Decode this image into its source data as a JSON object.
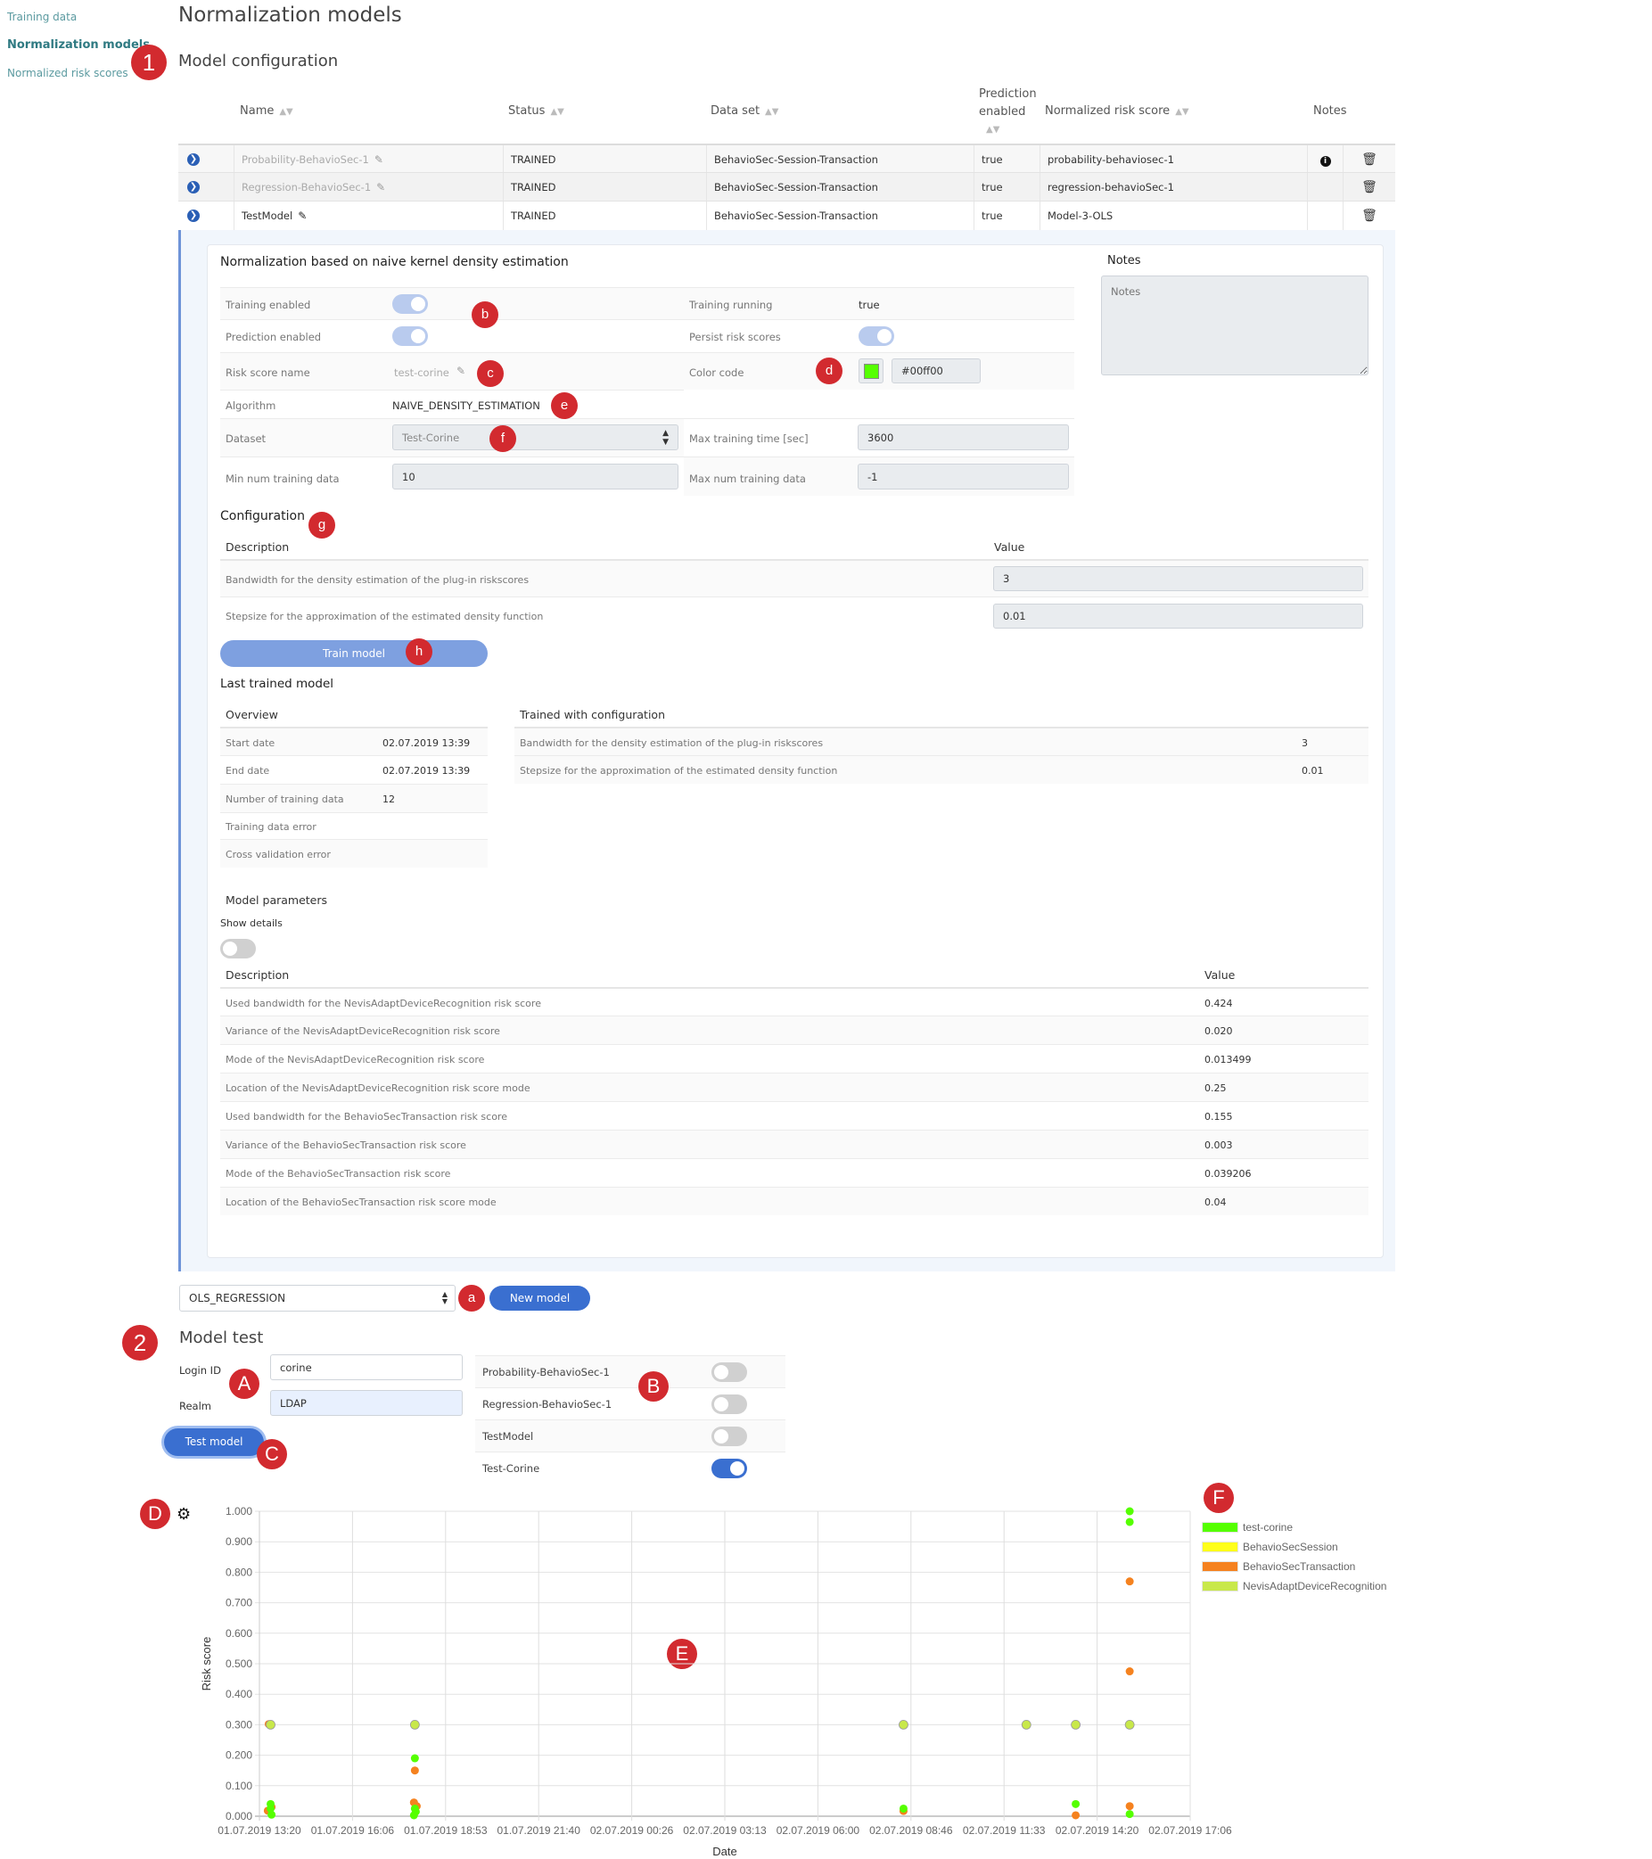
{
  "sidebar": {
    "items": [
      {
        "label": "Training data",
        "active": false
      },
      {
        "label": "Normalization models",
        "active": true
      },
      {
        "label": "Normalized risk scores",
        "active": false
      }
    ]
  },
  "page_title": "Normalization models",
  "annotations": {
    "n1": "1",
    "n2": "2",
    "a": "a",
    "b": "b",
    "c": "c",
    "d": "d",
    "e": "e",
    "f": "f",
    "g": "g",
    "h": "h",
    "A": "A",
    "B": "B",
    "C": "C",
    "D": "D",
    "E": "E",
    "F": "F"
  },
  "model_configuration": {
    "title": "Model configuration",
    "columns": {
      "name": "Name",
      "status": "Status",
      "dataset": "Data set",
      "prediction_enabled_1": "Prediction",
      "prediction_enabled_2": "enabled",
      "normalized_risk_score": "Normalized risk score",
      "notes": "Notes"
    },
    "rows": [
      {
        "name": "Probability-BehavioSec-1",
        "status": "TRAINED",
        "dataset": "BehavioSec-Session-Transaction",
        "prediction_enabled": "true",
        "normalized_risk_score": "probability-behaviosec-1",
        "has_note": true
      },
      {
        "name": "Regression-BehavioSec-1",
        "status": "TRAINED",
        "dataset": "BehavioSec-Session-Transaction",
        "prediction_enabled": "true",
        "normalized_risk_score": "regression-behavioSec-1",
        "has_note": false
      },
      {
        "name": "TestModel",
        "status": "TRAINED",
        "dataset": "BehavioSec-Session-Transaction",
        "prediction_enabled": "true",
        "normalized_risk_score": "Model-3-OLS",
        "has_note": false
      }
    ]
  },
  "detail": {
    "title": "Normalization based on naive kernel density estimation",
    "fields": {
      "training_enabled": {
        "label": "Training enabled",
        "value": true
      },
      "prediction_enabled": {
        "label": "Prediction enabled",
        "value": true
      },
      "risk_score_name": {
        "label": "Risk score name",
        "value": "test-corine"
      },
      "algorithm": {
        "label": "Algorithm",
        "value": "NAIVE_DENSITY_ESTIMATION"
      },
      "dataset": {
        "label": "Dataset",
        "value": "Test-Corine"
      },
      "min_num_training_data": {
        "label": "Min num training data",
        "value": "10"
      },
      "training_running": {
        "label": "Training running",
        "value": "true"
      },
      "persist_risk_scores": {
        "label": "Persist risk scores",
        "value": true
      },
      "color_code": {
        "label": "Color code",
        "value": "#00ff00",
        "swatch": "#55ff00"
      },
      "max_training_time": {
        "label": "Max training time [sec]",
        "value": "3600"
      },
      "max_num_training_data": {
        "label": "Max num training data",
        "value": "-1"
      }
    },
    "notes": {
      "label": "Notes",
      "placeholder": "Notes"
    },
    "configuration": {
      "title": "Configuration",
      "col_description": "Description",
      "col_value": "Value",
      "rows": [
        {
          "description": "Bandwidth for the density estimation of the plug-in riskscores",
          "value": "3"
        },
        {
          "description": "Stepsize for the approximation of the estimated density function",
          "value": "0.01"
        }
      ]
    },
    "train_button": "Train model",
    "last_trained": {
      "title": "Last trained model",
      "overview_title": "Overview",
      "overview": [
        {
          "label": "Start date",
          "value": "02.07.2019 13:39"
        },
        {
          "label": "End date",
          "value": "02.07.2019 13:39"
        },
        {
          "label": "Number of training data",
          "value": "12"
        },
        {
          "label": "Training data error",
          "value": ""
        },
        {
          "label": "Cross validation error",
          "value": ""
        }
      ],
      "trained_with_title": "Trained with configuration",
      "trained_with": [
        {
          "description": "Bandwidth for the density estimation of the plug-in riskscores",
          "value": "3"
        },
        {
          "description": "Stepsize for the approximation of the estimated density function",
          "value": "0.01"
        }
      ]
    },
    "model_parameters": {
      "title": "Model parameters",
      "show_details_label": "Show details",
      "show_details": false,
      "col_description": "Description",
      "col_value": "Value",
      "rows": [
        {
          "description": "Used bandwidth for the NevisAdaptDeviceRecognition risk score",
          "value": "0.424"
        },
        {
          "description": "Variance of the NevisAdaptDeviceRecognition risk score",
          "value": "0.020"
        },
        {
          "description": "Mode of the NevisAdaptDeviceRecognition risk score",
          "value": "0.013499"
        },
        {
          "description": "Location of the NevisAdaptDeviceRecognition risk score mode",
          "value": "0.25"
        },
        {
          "description": "Used bandwidth for the BehavioSecTransaction risk score",
          "value": "0.155"
        },
        {
          "description": "Variance of the BehavioSecTransaction risk score",
          "value": "0.003"
        },
        {
          "description": "Mode of the BehavioSecTransaction risk score",
          "value": "0.039206"
        },
        {
          "description": "Location of the BehavioSecTransaction risk score mode",
          "value": "0.04"
        }
      ]
    }
  },
  "new_model": {
    "algorithm_select": "OLS_REGRESSION",
    "button": "New model"
  },
  "model_test": {
    "title": "Model test",
    "login_id_label": "Login ID",
    "login_id_value": "corine",
    "realm_label": "Realm",
    "realm_value": "LDAP",
    "test_button": "Test model",
    "models": [
      {
        "name": "Probability-BehavioSec-1",
        "enabled": false
      },
      {
        "name": "Regression-BehavioSec-1",
        "enabled": false
      },
      {
        "name": "TestModel",
        "enabled": false
      },
      {
        "name": "Test-Corine",
        "enabled": true
      }
    ]
  },
  "chart_data": {
    "type": "scatter",
    "title": "",
    "xlabel": "Date",
    "ylabel": "Risk score",
    "grid": true,
    "legend_position": "right",
    "ylim": [
      0,
      1
    ],
    "yticks": [
      "0.000",
      "0.100",
      "0.200",
      "0.300",
      "0.400",
      "0.500",
      "0.600",
      "0.700",
      "0.800",
      "0.900",
      "1.000"
    ],
    "xticks": [
      "01.07.2019 13:20",
      "01.07.2019 16:06",
      "01.07.2019 18:53",
      "01.07.2019 21:40",
      "02.07.2019 00:26",
      "02.07.2019 03:13",
      "02.07.2019 06:00",
      "02.07.2019 08:46",
      "02.07.2019 11:33",
      "02.07.2019 14:20",
      "02.07.2019 17:06"
    ],
    "x_unit": "tick index (0 = 01.07.2019 13:20, step 2h46m40s)",
    "series": [
      {
        "name": "test-corine",
        "color": "#55ff00",
        "points": [
          [
            0.12,
            0.04
          ],
          [
            0.12,
            0.025
          ],
          [
            0.13,
            0.005
          ],
          [
            1.67,
            0.19
          ],
          [
            1.67,
            0.025
          ],
          [
            1.68,
            0.015
          ],
          [
            1.66,
            0.003
          ],
          [
            6.92,
            0.025
          ],
          [
            8.77,
            0.04
          ],
          [
            9.35,
            1.0
          ],
          [
            9.35,
            0.965
          ],
          [
            9.35,
            0.007
          ]
        ]
      },
      {
        "name": "BehavioSecSession",
        "color": "#ffff1a",
        "points": []
      },
      {
        "name": "BehavioSecTransaction",
        "color": "#f5821f",
        "points": [
          [
            0.1,
            0.302
          ],
          [
            0.09,
            0.018
          ],
          [
            0.13,
            0.03
          ],
          [
            1.67,
            0.15
          ],
          [
            1.66,
            0.045
          ],
          [
            1.69,
            0.033
          ],
          [
            6.92,
            0.017
          ],
          [
            8.77,
            0.003
          ],
          [
            9.35,
            0.77
          ],
          [
            9.35,
            0.475
          ],
          [
            9.35,
            0.033
          ]
        ]
      },
      {
        "name": "NevisAdaptDeviceRecognition",
        "color": "#c8e84a",
        "points": [
          [
            0.12,
            0.3
          ],
          [
            1.67,
            0.3
          ],
          [
            6.92,
            0.3
          ],
          [
            8.24,
            0.3
          ],
          [
            8.77,
            0.3
          ],
          [
            9.35,
            0.3
          ]
        ]
      }
    ]
  }
}
